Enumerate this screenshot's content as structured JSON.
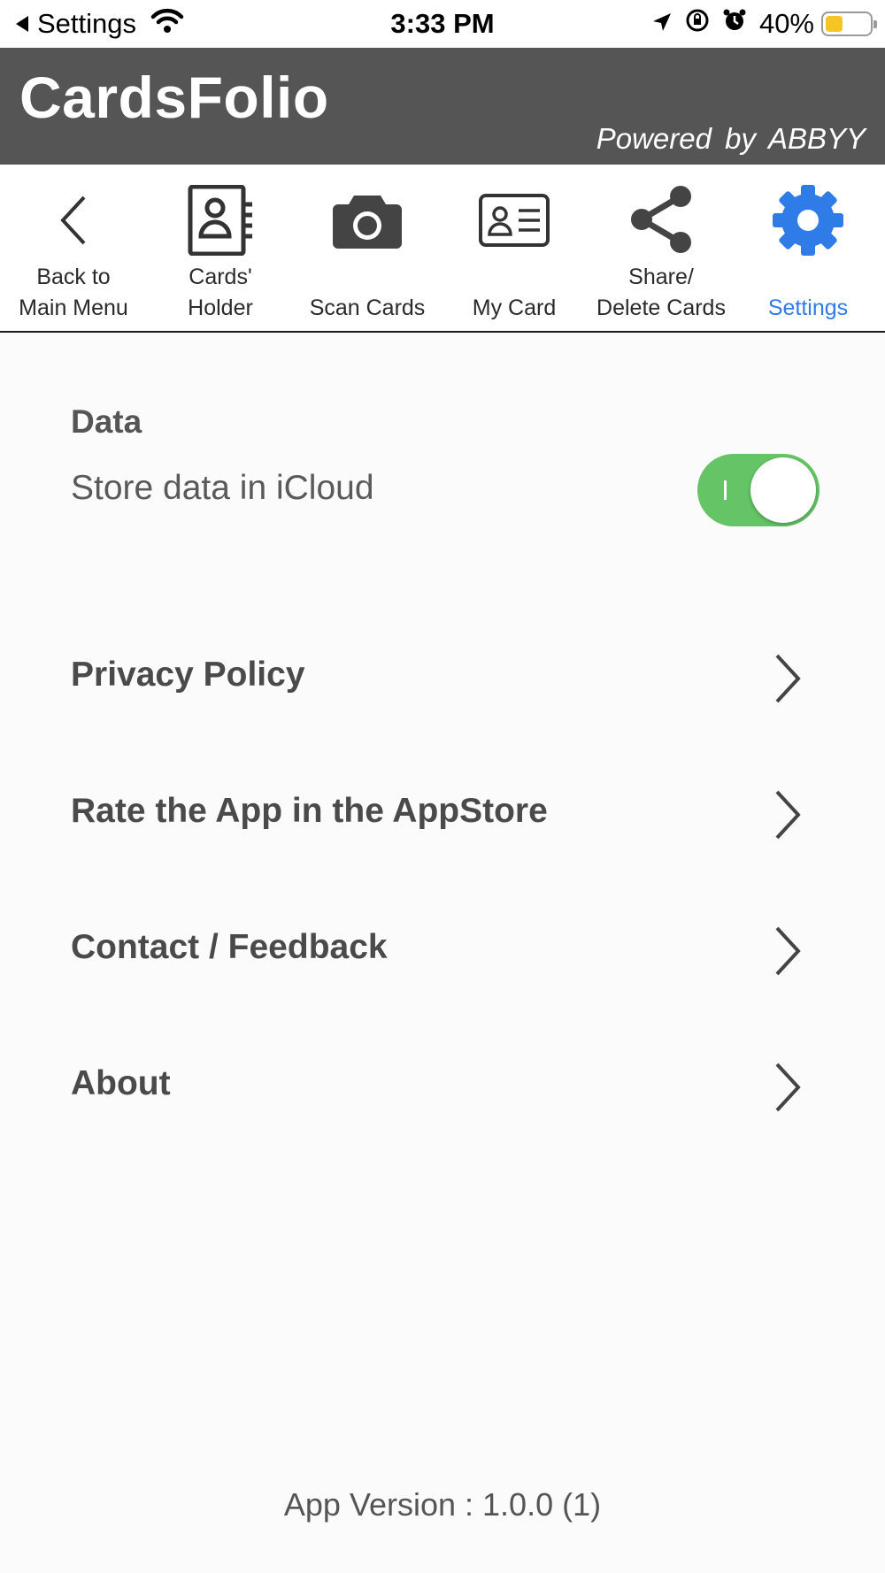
{
  "status_bar": {
    "back_app": "Settings",
    "time": "3:33 PM",
    "battery": "40%",
    "battery_level": 0.4,
    "icons": [
      "back-arrow-icon",
      "wifi-icon",
      "location-icon",
      "rotation-lock-icon",
      "alarm-icon",
      "battery-icon"
    ]
  },
  "header": {
    "title": "CardsFolio",
    "subtitle": "Powered  by ABBYY",
    "background": "#555555"
  },
  "toolbar": {
    "items": [
      {
        "label": "Back to\nMain Menu",
        "icon": "chevron-left-icon"
      },
      {
        "label": "Cards'\nHolder",
        "icon": "contact-book-icon"
      },
      {
        "label": "Scan Cards",
        "icon": "camera-icon"
      },
      {
        "label": "My Card",
        "icon": "id-card-icon"
      },
      {
        "label": "Share/\nDelete Cards",
        "icon": "share-icon"
      },
      {
        "label": "Settings",
        "icon": "gear-icon",
        "active": true
      }
    ],
    "active_color": "#2f7be8"
  },
  "settings": {
    "data_section_title": "Data",
    "icloud_label": "Store data in iCloud",
    "icloud_enabled": true,
    "toggle_color": "#64c466",
    "menu": [
      {
        "label": "Privacy Policy"
      },
      {
        "label": "Rate the App in the AppStore"
      },
      {
        "label": "Contact / Feedback"
      },
      {
        "label": "About"
      }
    ],
    "version": "App Version : 1.0.0 (1)"
  }
}
